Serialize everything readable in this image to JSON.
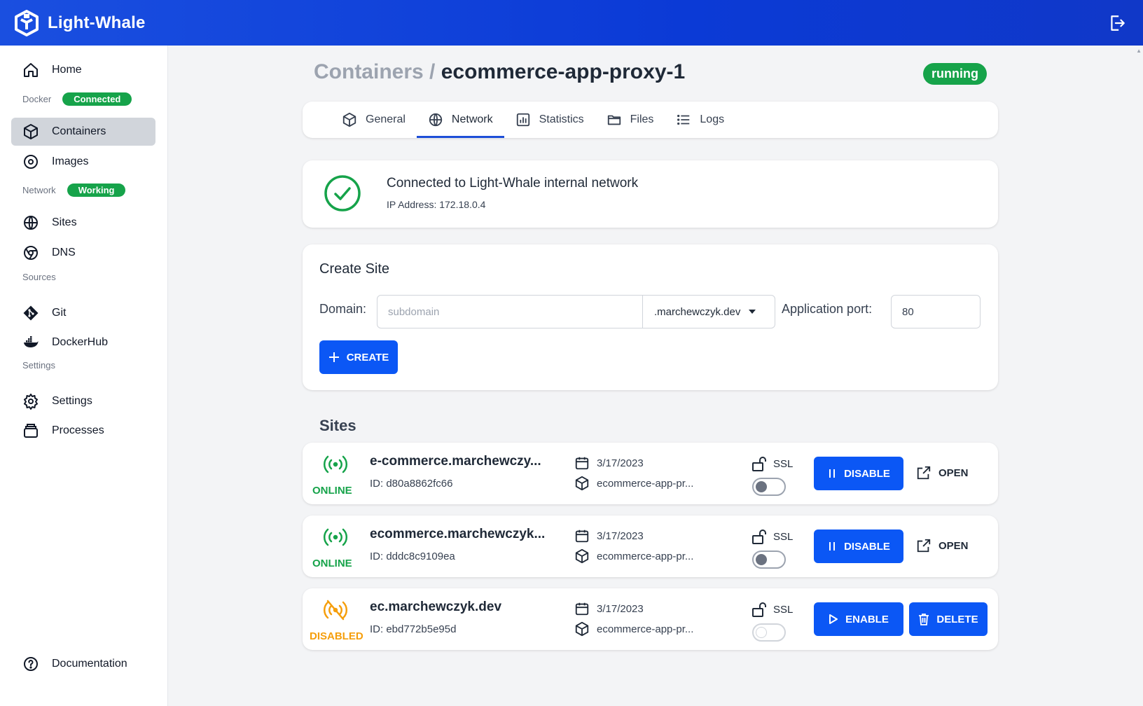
{
  "app": {
    "title": "Light-Whale"
  },
  "sidebar": {
    "home": "Home",
    "docker_section": "Docker",
    "docker_badge": "Connected",
    "containers": "Containers",
    "images": "Images",
    "network_section": "Network",
    "network_badge": "Working",
    "sites": "Sites",
    "dns": "DNS",
    "sources_section": "Sources",
    "git": "Git",
    "dockerhub": "DockerHub",
    "settings_section": "Settings",
    "settings": "Settings",
    "processes": "Processes",
    "documentation": "Documentation"
  },
  "page": {
    "breadcrumb": "Containers /",
    "container_name": "ecommerce-app-proxy-1",
    "status": "running"
  },
  "tabs": {
    "general": "General",
    "network": "Network",
    "statistics": "Statistics",
    "files": "Files",
    "logs": "Logs"
  },
  "network": {
    "title": "Connected to Light-Whale internal network",
    "ip": "IP Address: 172.18.0.4"
  },
  "create_site": {
    "title": "Create Site",
    "domain_label": "Domain:",
    "domain_placeholder": "subdomain",
    "domain_suffix": ".marchewczyk.dev",
    "port_label": "Application port:",
    "port_value": "80",
    "create_button": "CREATE"
  },
  "sites_heading": "Sites",
  "sites": [
    {
      "status": "ONLINE",
      "name": "e-commerce.marchewczy...",
      "id": "ID: d80a8862fc66",
      "date": "3/17/2023",
      "container": "ecommerce-app-pr...",
      "ssl": "SSL",
      "ssl_enabled": false,
      "primary_button": "DISABLE",
      "secondary": "OPEN"
    },
    {
      "status": "ONLINE",
      "name": "ecommerce.marchewczyk...",
      "id": "ID: dddc8c9109ea",
      "date": "3/17/2023",
      "container": "ecommerce-app-pr...",
      "ssl": "SSL",
      "ssl_enabled": false,
      "primary_button": "DISABLE",
      "secondary": "OPEN"
    },
    {
      "status": "DISABLED",
      "name": "ec.marchewczyk.dev",
      "id": "ID: ebd772b5e95d",
      "date": "3/17/2023",
      "container": "ecommerce-app-pr...",
      "ssl": "SSL",
      "ssl_enabled": false,
      "primary_button": "ENABLE",
      "secondary": "DELETE"
    }
  ],
  "colors": {
    "brand_blue": "#0b57f5",
    "online_green": "#16a34a",
    "disabled_orange": "#f59e0b"
  }
}
